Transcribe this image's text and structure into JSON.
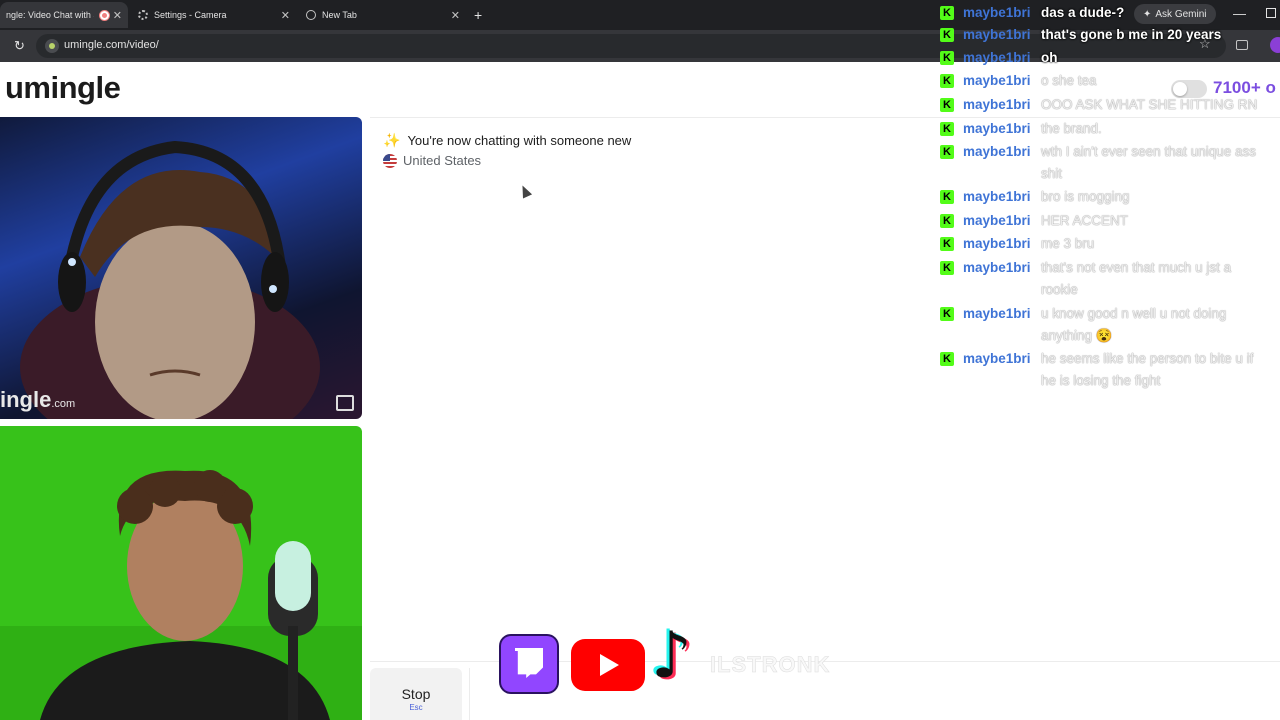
{
  "browser": {
    "tabs": [
      {
        "label": "ngle: Video Chat with S",
        "active": true
      },
      {
        "label": "Settings - Camera",
        "active": false
      },
      {
        "label": "New Tab",
        "active": false
      }
    ],
    "new_tab_symbol": "+",
    "close_symbol": "✕",
    "url": "umingle.com/video/",
    "gemini_label": "Ask Gemini",
    "minimize_symbol": "—",
    "reload_symbol": "↻",
    "star_symbol": "☆",
    "icons": [
      "recording-icon",
      "gear-icon",
      "globe-icon",
      "reload-icon",
      "star-icon",
      "extensions-icon",
      "profile-icon"
    ]
  },
  "app": {
    "logo": "umingle",
    "watermark": "ingle",
    "watermark_suffix": ".com",
    "notice": "You're now chatting with someone new",
    "country": "United States",
    "stop_label": "Stop",
    "stop_key": "Esc",
    "online_count": "7100+ o",
    "accent_color": "#7b4ee0"
  },
  "overlay": {
    "tiktok_glyph": "♪",
    "handle": "ILSTRONK",
    "chat": [
      {
        "user": "maybe1bri",
        "text": "das a dude-?",
        "bright": true
      },
      {
        "user": "maybe1bri",
        "text": "that's gone b me in 20 years",
        "bright": true
      },
      {
        "user": "maybe1bri",
        "text": "oh",
        "bright": true
      },
      {
        "user": "maybe1bri",
        "text": "o she tea",
        "bright": false
      },
      {
        "user": "maybe1bri",
        "text": "OOO ASK WHAT SHE HITTING RN",
        "bright": false
      },
      {
        "user": "maybe1bri",
        "text": "the brand.",
        "bright": false
      },
      {
        "user": "maybe1bri",
        "text": "wth I ain't ever seen that unique ass shit",
        "bright": false
      },
      {
        "user": "maybe1bri",
        "text": "bro is mogging",
        "bright": false
      },
      {
        "user": "maybe1bri",
        "text": "HER ACCENT",
        "bright": false
      },
      {
        "user": "maybe1bri",
        "text": "me 3 bru",
        "bright": false
      },
      {
        "user": "maybe1bri",
        "text": "that's not even that much u jst a rookie",
        "bright": false
      },
      {
        "user": "maybe1bri",
        "text": "u know good n well u not doing anything 😵",
        "bright": false
      },
      {
        "user": "maybe1bri",
        "text": "he seems like the person to bite u if he is losing the fight",
        "bright": false
      }
    ],
    "badge_letter": "K",
    "badge_color": "#53fc18",
    "username_color": "#3f74d6"
  }
}
